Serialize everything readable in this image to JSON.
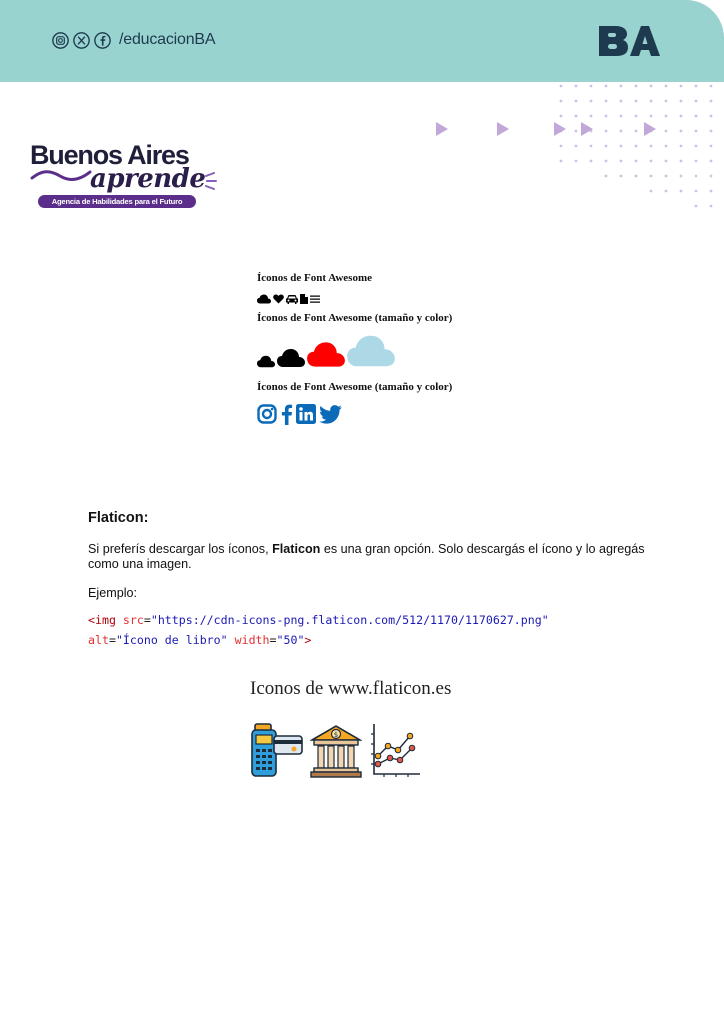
{
  "header": {
    "social_handle": "/educacionBA",
    "social_icons": [
      "instagram-icon",
      "x-icon",
      "facebook-icon"
    ],
    "logo_text": "BA",
    "colors": {
      "band": "#99d3d0",
      "logo": "#1d3a4f"
    }
  },
  "brand": {
    "title": "Buenos Aires",
    "subtitle": "aprende",
    "tagline": "Agencia de Habilidades para el Futuro"
  },
  "font_awesome_demo": {
    "heading_1": "Íconos de Font Awesome",
    "icons_small": [
      "cloud-icon",
      "heart-icon",
      "car-icon",
      "file-icon",
      "bars-icon"
    ],
    "heading_2": "Íconos de Font Awesome (tamaño y color)",
    "cloud_colors": [
      "#000000",
      "#000000",
      "#ff0000",
      "#add8e6"
    ],
    "heading_3": "Íconos de Font Awesome (tamaño y color)",
    "social_icons": [
      "instagram-icon",
      "facebook-icon",
      "linkedin-icon",
      "twitter-icon"
    ],
    "social_color": "#0b6bb8"
  },
  "section": {
    "title": "Flaticon:",
    "p1_before": "Si preferís descargar los íconos, ",
    "p1_bold": "Flaticon",
    "p1_after": " es una gran opción. Solo descargás el ícono y lo agregás como una imagen.",
    "example_label": "Ejemplo:",
    "code": {
      "tag": "<img",
      "src_attr": "src",
      "src_val": "\"https://cdn-icons-png.flaticon.com/512/1170/1170627.png\"",
      "alt_attr": "alt",
      "alt_val": "\"Ícono de libro\"",
      "width_attr": "width",
      "width_val": "\"50\"",
      "close": ">"
    }
  },
  "flaticon_demo": {
    "title": "Iconos de www.flaticon.es",
    "icons": [
      "card-terminal-icon",
      "bank-icon",
      "line-chart-icon"
    ]
  }
}
